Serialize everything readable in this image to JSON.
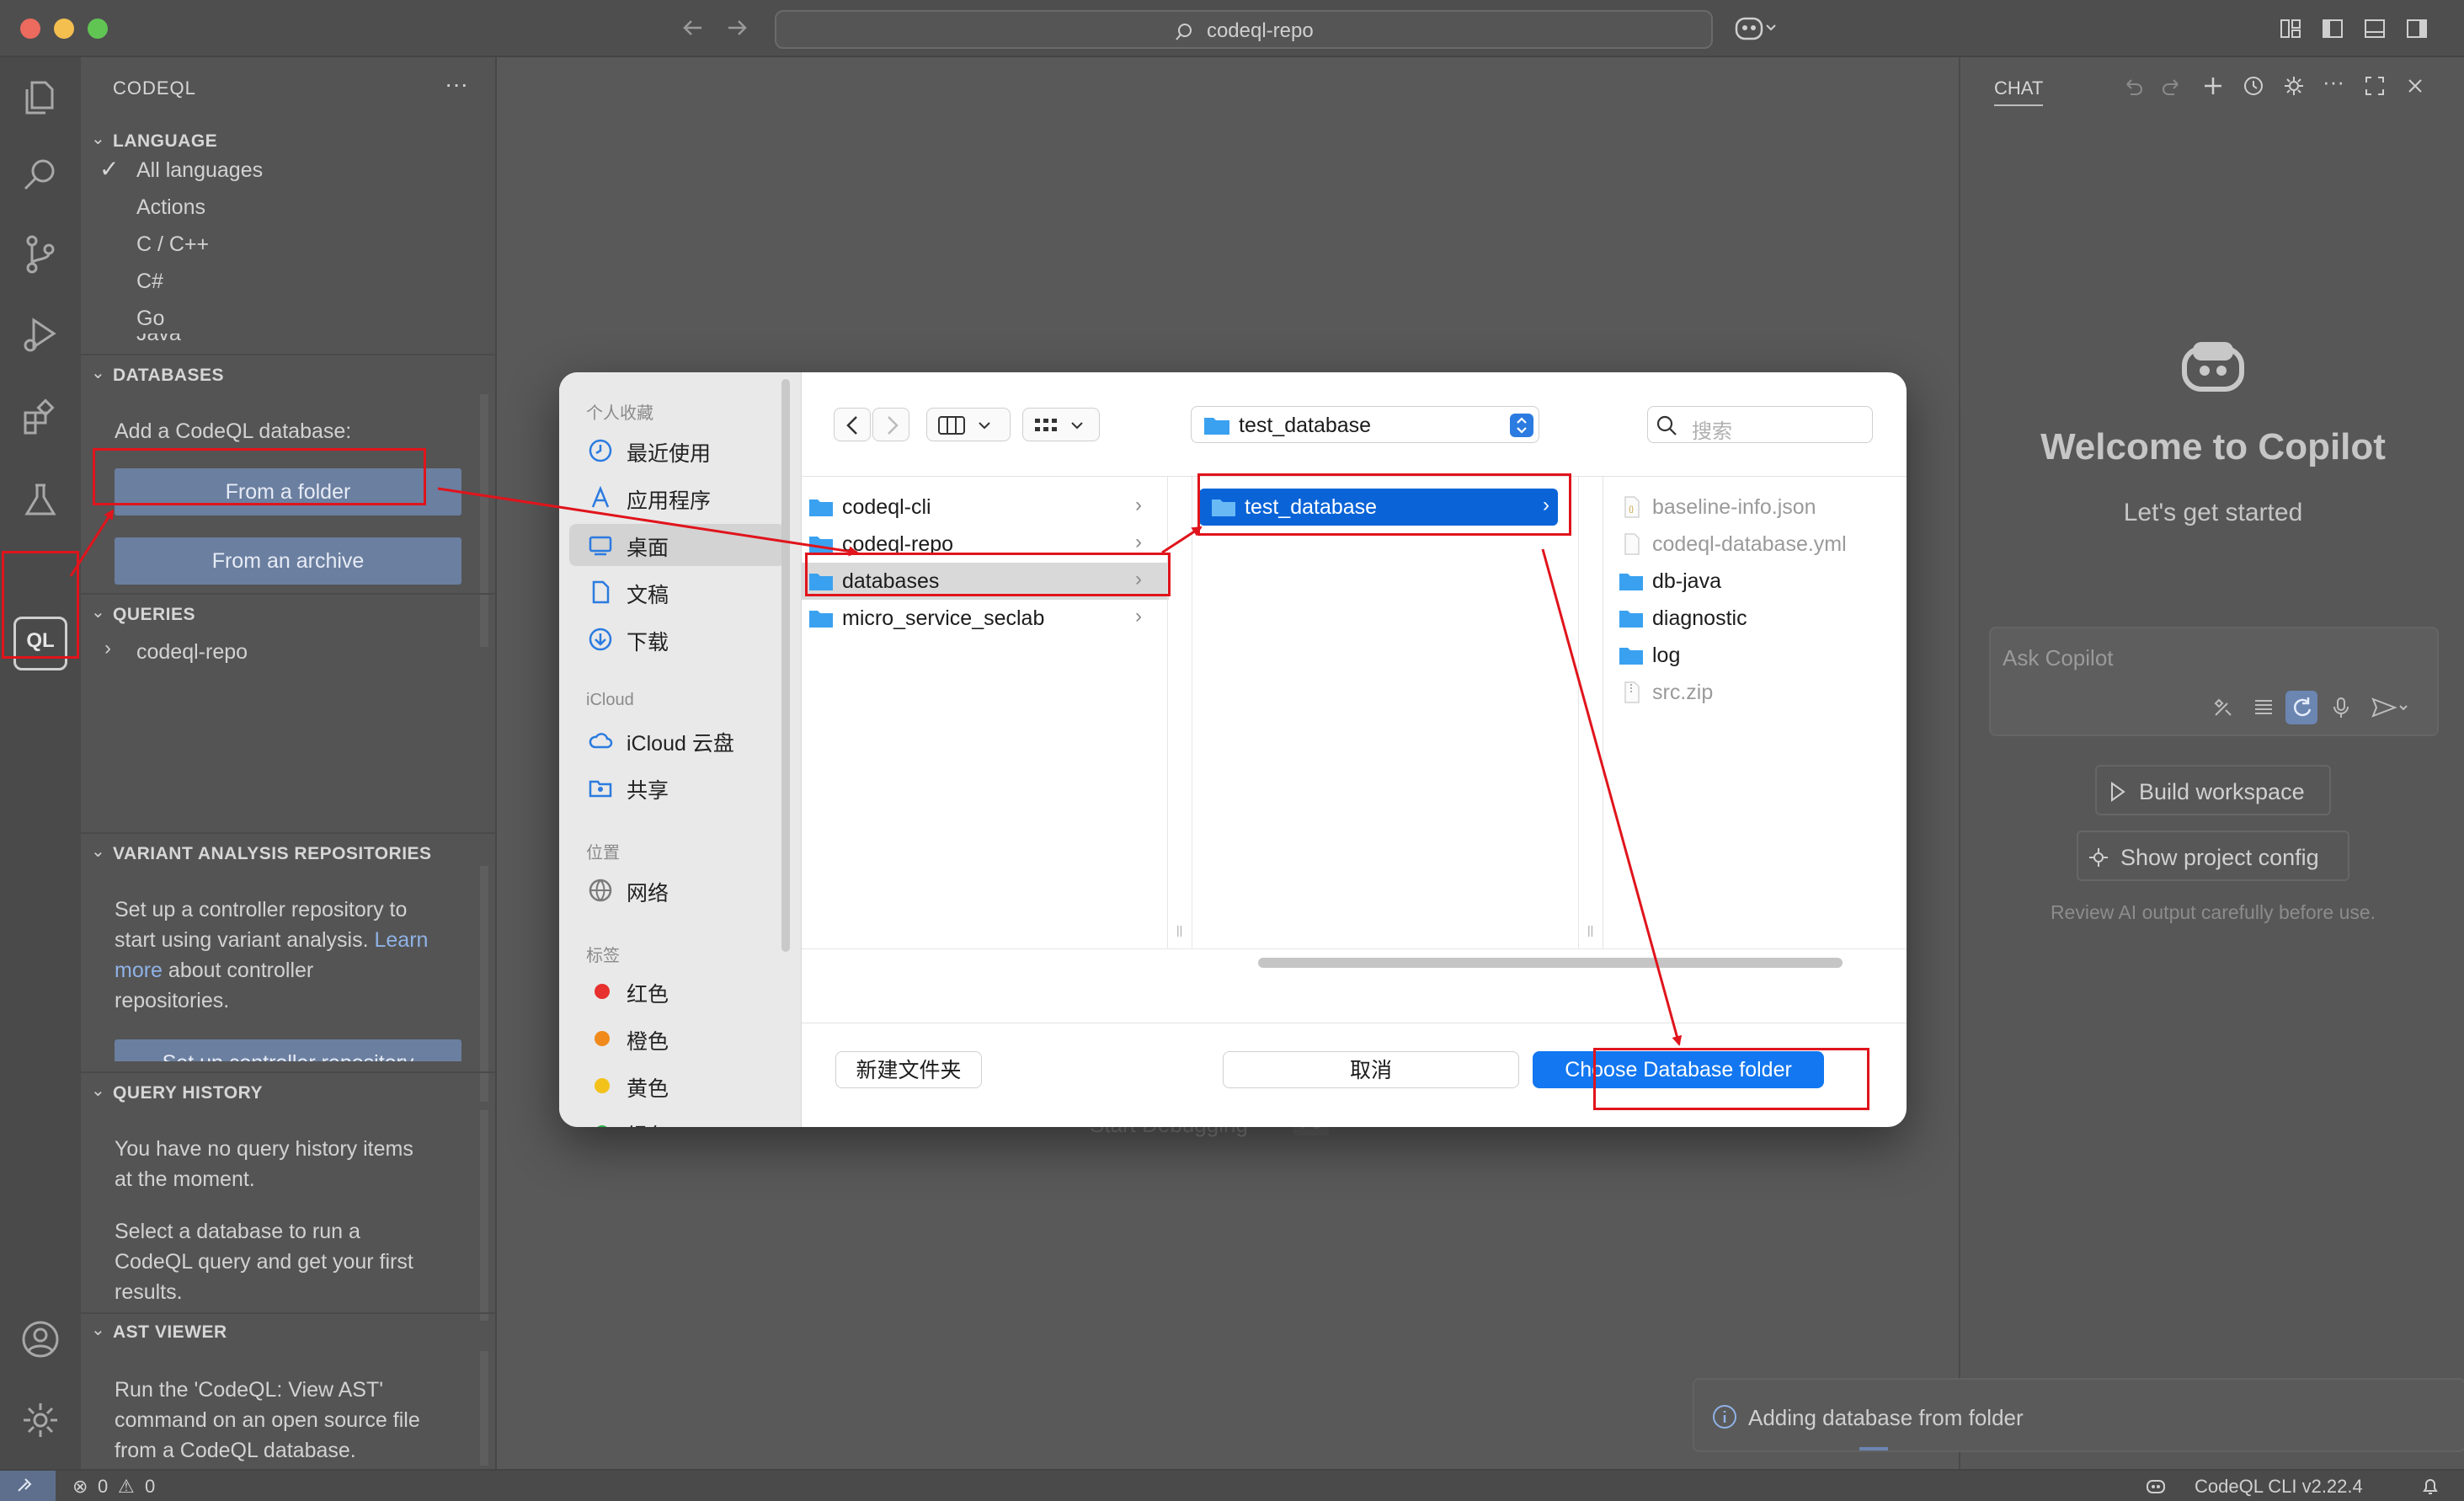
{
  "titlebar": {
    "search_text": "codeql-repo"
  },
  "sidebar": {
    "title": "CODEQL",
    "more": "···",
    "language": {
      "header": "LANGUAGE",
      "items": [
        "All languages",
        "Actions",
        "C / C++",
        "C#",
        "Go"
      ],
      "partial": "Java"
    },
    "databases": {
      "header": "DATABASES",
      "prompt": "Add a CodeQL database:",
      "from_folder": "From a folder",
      "from_archive": "From an archive"
    },
    "queries": {
      "header": "QUERIES",
      "item": "codeql-repo"
    },
    "variant": {
      "header": "VARIANT ANALYSIS REPOSITORIES",
      "line1": "Set up a controller repository to",
      "line2_pre": "start using variant analysis. ",
      "line2_link": "Learn",
      "line3_link": "more",
      "line3_post": " about controller",
      "line4": "repositories.",
      "button": "Set up controller repository"
    },
    "history": {
      "header": "QUERY HISTORY",
      "p1_l1": "You have no query history items",
      "p1_l2": "at the moment.",
      "p2_l1": "Select a database to run a",
      "p2_l2": "CodeQL query and get your first",
      "p2_l3": "results."
    },
    "ast": {
      "header": "AST VIEWER",
      "l1": "Run the 'CodeQL: View AST'",
      "l2": "command on an open source file",
      "l3": "from a CodeQL database."
    }
  },
  "editor": {
    "hint_label": "Start Debugging",
    "hint_key": "F5"
  },
  "chat": {
    "tab": "CHAT",
    "welcome": "Welcome to Copilot",
    "subtitle": "Let's get started",
    "input_placeholder": "Ask Copilot",
    "build_button": "Build workspace",
    "config_button": "Show project config",
    "disclaimer": "Review AI output carefully before use.",
    "toast": "Adding database from folder"
  },
  "statusbar": {
    "errors": "0",
    "warnings": "0",
    "cli_version": "CodeQL CLI v2.22.4"
  },
  "dialog": {
    "favorites_header": "个人收藏",
    "favorites": [
      "最近使用",
      "应用程序",
      "桌面",
      "文稿",
      "下载"
    ],
    "icloud_header": "iCloud",
    "icloud": [
      "iCloud 云盘",
      "共享"
    ],
    "location_header": "位置",
    "locations": [
      "网络"
    ],
    "tags_header": "标签",
    "tags": [
      {
        "name": "红色",
        "color": "#e8302e"
      },
      {
        "name": "橙色",
        "color": "#f08a1d"
      },
      {
        "name": "黄色",
        "color": "#f2c21b"
      },
      {
        "name": "绿色",
        "color": "#2bb14a"
      }
    ],
    "path_popup": "test_database",
    "search_placeholder": "搜索",
    "col1": [
      "codeql-cli",
      "codeql-repo",
      "databases",
      "micro_service_seclab"
    ],
    "col2": [
      "test_database"
    ],
    "col3": [
      {
        "name": "baseline-info.json",
        "dim": true,
        "kind": "file"
      },
      {
        "name": "codeql-database.yml",
        "dim": true,
        "kind": "file"
      },
      {
        "name": "db-java",
        "dim": false,
        "kind": "folder"
      },
      {
        "name": "diagnostic",
        "dim": false,
        "kind": "folder"
      },
      {
        "name": "log",
        "dim": false,
        "kind": "folder"
      },
      {
        "name": "src.zip",
        "dim": true,
        "kind": "file"
      }
    ],
    "new_folder": "新建文件夹",
    "cancel": "取消",
    "choose": "Choose Database folder"
  }
}
